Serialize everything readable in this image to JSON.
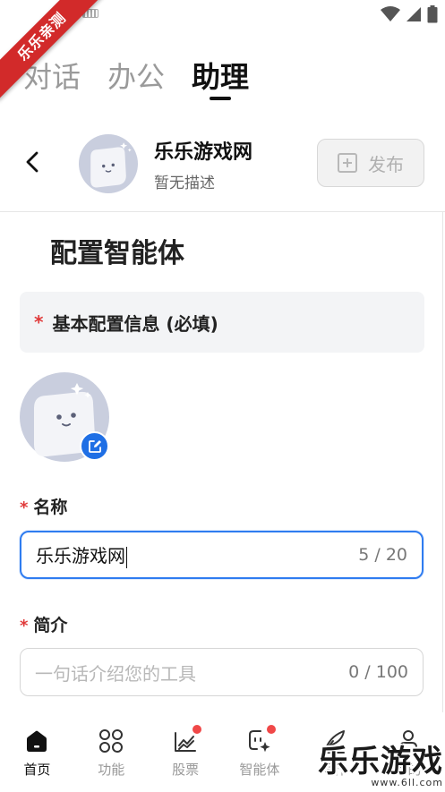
{
  "status_bar": {
    "icons": [
      "keyboard-icon",
      "wifi-icon",
      "signal-icon",
      "battery-icon"
    ]
  },
  "ribbon": {
    "text": "乐乐亲测"
  },
  "top_tabs": [
    {
      "label": "对话",
      "active": false
    },
    {
      "label": "办公",
      "active": false
    },
    {
      "label": "助理",
      "active": true
    }
  ],
  "header": {
    "name": "乐乐游戏网",
    "description": "暂无描述",
    "publish_label": "发布"
  },
  "main": {
    "title": "配置智能体",
    "section": {
      "required_mark": "*",
      "label": "基本配置信息 (必填)"
    },
    "name_field": {
      "required_mark": "*",
      "label": "名称",
      "value": "乐乐游戏网",
      "counter": "5 / 20"
    },
    "intro_field": {
      "required_mark": "*",
      "label": "简介",
      "placeholder": "一句话介绍您的工具",
      "counter": "0 / 100"
    }
  },
  "bottom_nav": [
    {
      "label": "首页",
      "icon": "home-icon",
      "active": true,
      "dot": false
    },
    {
      "label": "功能",
      "icon": "grid-icon",
      "active": false,
      "dot": false
    },
    {
      "label": "股票",
      "icon": "stock-chart-icon",
      "active": false,
      "dot": true
    },
    {
      "label": "智能体",
      "icon": "agent-icon",
      "active": false,
      "dot": true
    },
    {
      "label": "写作",
      "icon": "quill-icon",
      "active": false,
      "dot": false
    },
    {
      "label": "我的",
      "icon": "profile-icon",
      "active": false,
      "dot": false
    }
  ],
  "watermark": {
    "text": "乐乐游戏",
    "url": "www.6ll.com"
  },
  "colors": {
    "accent": "#1f6fe5",
    "focus": "#2f7cf0",
    "required": "#e03a3a",
    "badge_dot": "#f04848",
    "ribbon": "#d22a2a"
  }
}
